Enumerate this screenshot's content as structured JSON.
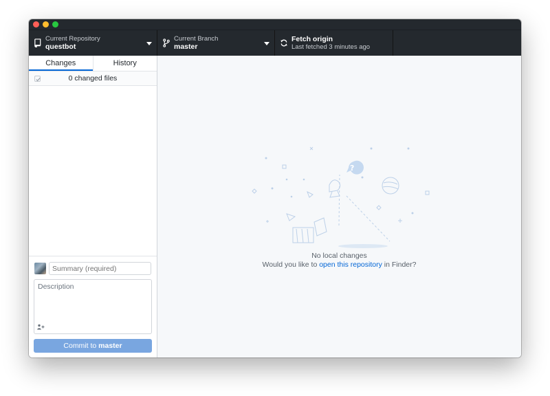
{
  "window": {
    "traffic_lights": [
      "close",
      "minimize",
      "zoom"
    ]
  },
  "toolbar": {
    "repository": {
      "label": "Current Repository",
      "value": "questbot",
      "icon": "repo-icon"
    },
    "branch": {
      "label": "Current Branch",
      "value": "master",
      "icon": "branch-icon"
    },
    "fetch": {
      "label": "Fetch origin",
      "status": "Last fetched 3 minutes ago",
      "icon": "sync-icon"
    }
  },
  "sidebar": {
    "tabs": [
      {
        "label": "Changes",
        "active": true
      },
      {
        "label": "History",
        "active": false
      }
    ],
    "changed_files_label": "0 changed files",
    "select_all_checked": true
  },
  "commit": {
    "summary_placeholder": "Summary (required)",
    "description_placeholder": "Description",
    "button_prefix": "Commit to",
    "button_branch": "master"
  },
  "main": {
    "title": "No local changes",
    "prefix": "Would you like to",
    "link_text": "open this repository",
    "suffix": "in Finder?"
  },
  "colors": {
    "toolbar_bg": "#24292e",
    "accent": "#0366d6",
    "commit_button": "#79a6e0",
    "main_bg": "#f6f8fa"
  }
}
